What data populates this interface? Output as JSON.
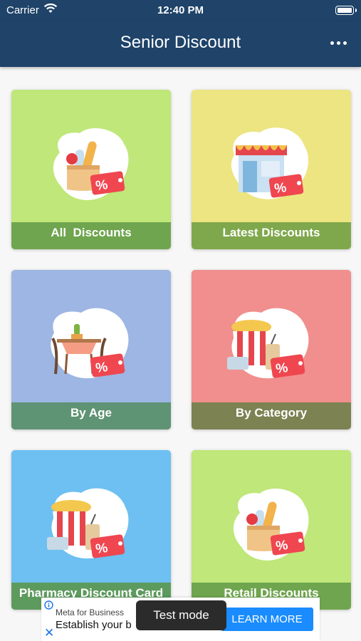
{
  "status_bar": {
    "carrier": "Carrier",
    "time": "12:40 PM"
  },
  "nav": {
    "title": "Senior Discount",
    "more_icon": "more-horizontal-icon"
  },
  "tiles": [
    {
      "label": "All  Discounts",
      "art": "grocery-bag-discount",
      "bg_color": "#bfe779",
      "label_color": "#6fa54e"
    },
    {
      "label": "Latest Discounts",
      "art": "storefront-discount",
      "bg_color": "#ece581",
      "label_color": "#7fa84c"
    },
    {
      "label": "By Age",
      "art": "dining-table-discount",
      "bg_color": "#9db6e3",
      "label_color": "#5e9373"
    },
    {
      "label": "By Category",
      "art": "popcorn-snacks-discount",
      "bg_color": "#f08f8d",
      "label_color": "#7c8251"
    },
    {
      "label": "Pharmacy Discount Card",
      "art": "popcorn-snacks-discount",
      "bg_color": "#6dc0f1",
      "label_color": "#5d9a5e"
    },
    {
      "label": "Retail Discounts",
      "art": "grocery-bag-discount",
      "bg_color": "#bfe779",
      "label_color": "#6fa54e"
    }
  ],
  "ad": {
    "advertiser": "Meta for Business",
    "headline": "Establish your b",
    "cta": "LEARN MORE",
    "toast": "Test mode",
    "cta_color": "#1a8cff"
  }
}
